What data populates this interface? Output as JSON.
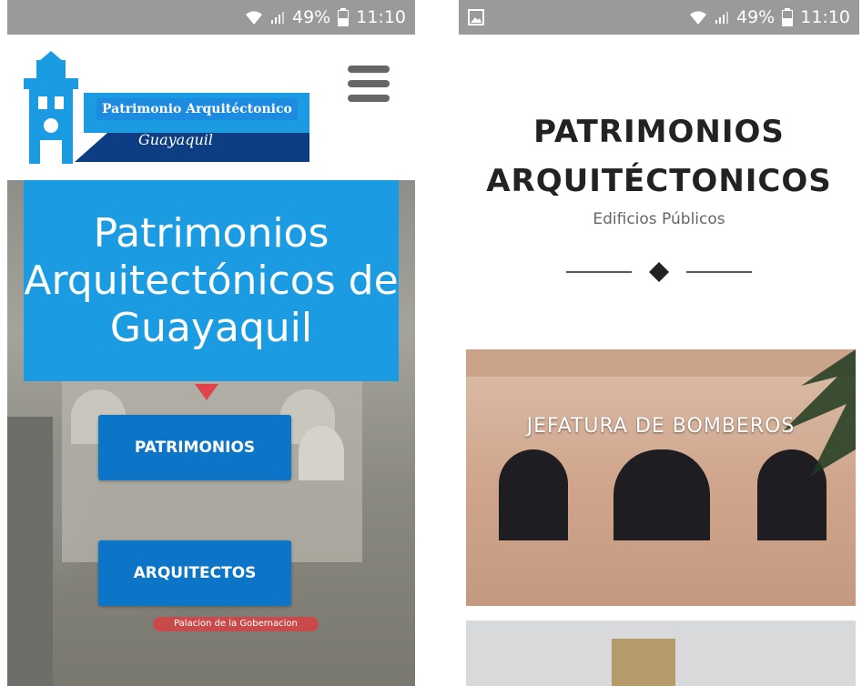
{
  "left_screen": {
    "status": {
      "battery": "49%",
      "time": "11:10"
    },
    "logo": {
      "line1": "Patrimonio Arquitéctonico",
      "line2": "Guayaquil"
    },
    "hero": {
      "title": "Patrimonios Arquitectónicos de Guayaquil",
      "map_label": "Palacion de la Gobernacion"
    },
    "buttons": {
      "patrimonios": "PATRIMONIOS",
      "arquitectos": "ARQUITECTOS"
    }
  },
  "right_screen": {
    "status": {
      "battery": "49%",
      "time": "11:10"
    },
    "title": "PATRIMONIOS ARQUITÉCTONICOS",
    "subtitle": "Edificios Públicos",
    "cards": [
      {
        "label": "JEFATURA DE BOMBEROS"
      }
    ]
  },
  "colors": {
    "status_bar": "#9a9a9a",
    "hero_blue": "#1a9be2",
    "button_blue": "#0c75c7"
  }
}
